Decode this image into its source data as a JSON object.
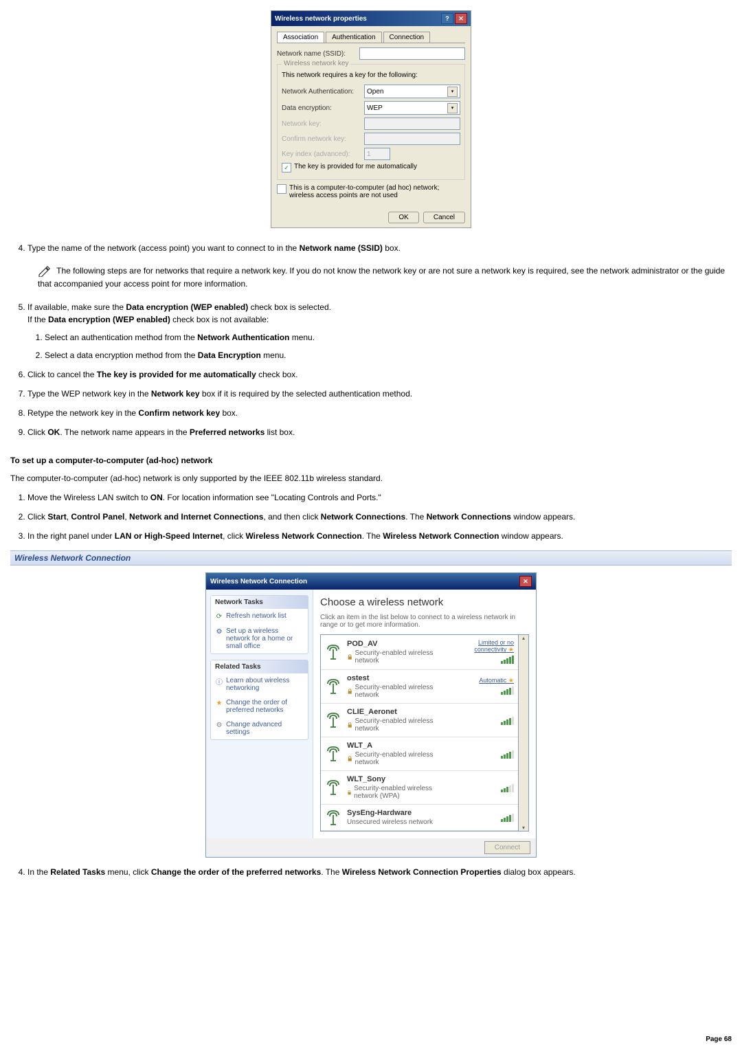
{
  "properties_dialog": {
    "title": "Wireless network properties",
    "tabs": {
      "association": "Association",
      "authentication": "Authentication",
      "connection": "Connection"
    },
    "network_name_label": "Network name (SSID):",
    "wireless_key_group": "Wireless network key",
    "requires_text": "This network requires a key for the following:",
    "net_auth_label": "Network Authentication:",
    "net_auth_value": "Open",
    "data_enc_label": "Data encryption:",
    "data_enc_value": "WEP",
    "net_key_label": "Network key:",
    "confirm_key_label": "Confirm network key:",
    "key_index_label": "Key index (advanced):",
    "key_index_value": "1",
    "auto_key_label": "The key is provided for me automatically",
    "adhoc_label": "This is a computer-to-computer (ad hoc) network; wireless access points are not used",
    "ok": "OK",
    "cancel": "Cancel"
  },
  "step4": "Type the name of the network (access point) you want to connect to in the ",
  "step4_bold": "Network name (SSID)",
  "step4_end": " box.",
  "note": "The following steps are for networks that require a network key. If you do not know the network key or are not sure a network key is required, see the network administrator or the guide that accompanied your access point for more information.",
  "step5a": "If available, make sure the ",
  "step5a_bold": "Data encryption (WEP enabled)",
  "step5a_end": " check box is selected.",
  "step5b": "If the ",
  "step5b_bold": "Data encryption (WEP enabled)",
  "step5b_end": " check box is not available:",
  "step5_1a": "Select an authentication method from the ",
  "step5_1b": "Network Authentication",
  "step5_1c": " menu.",
  "step5_2a": "Select a data encryption method from the ",
  "step5_2b": "Data Encryption",
  "step5_2c": " menu.",
  "step6a": "Click to cancel the ",
  "step6b": "The key is provided for me automatically",
  "step6c": " check box.",
  "step7a": "Type the WEP network key in the ",
  "step7b": "Network key",
  "step7c": " box if it is required by the selected authentication method.",
  "step8a": "Retype the network key in the ",
  "step8b": "Confirm network key",
  "step8c": " box.",
  "step9a": "Click ",
  "step9b": "OK",
  "step9c": ". The network name appears in the ",
  "step9d": "Preferred networks",
  "step9e": " list box.",
  "adhoc_heading": "To set up a computer-to-computer (ad-hoc) network",
  "adhoc_intro": "The computer-to-computer (ad-hoc) network is only supported by the IEEE 802.11b wireless standard.",
  "adhoc1a": "Move the Wireless LAN switch to ",
  "adhoc1b": "ON",
  "adhoc1c": ". For location information see \"Locating Controls and Ports.\"",
  "adhoc2a": "Click ",
  "adhoc2b": "Start",
  "adhoc2c": ", ",
  "adhoc2d": "Control Panel",
  "adhoc2e": ", ",
  "adhoc2f": "Network and Internet Connections",
  "adhoc2g": ", and then click ",
  "adhoc2h": "Network Connections",
  "adhoc2i": ". The ",
  "adhoc2j": "Network Connections",
  "adhoc2k": " window appears.",
  "adhoc3a": "In the right panel under ",
  "adhoc3b": "LAN or High-Speed Internet",
  "adhoc3c": ", click ",
  "adhoc3d": "Wireless Network Connection",
  "adhoc3e": ". The ",
  "adhoc3f": "Wireless Network Connection",
  "adhoc3g": " window appears.",
  "caption": "Wireless Network Connection",
  "wnc": {
    "title": "Wireless Network Connection",
    "net_tasks": "Network Tasks",
    "refresh": "Refresh network list",
    "setup": "Set up a wireless network for a home or small office",
    "related": "Related Tasks",
    "learn": "Learn about wireless networking",
    "change_order": "Change the order of preferred networks",
    "change_adv": "Change advanced settings",
    "choose": "Choose a wireless network",
    "desc": "Click an item in the list below to connect to a wireless network in range or to get more information.",
    "nets": [
      {
        "name": "POD_AV",
        "sec": "Security-enabled wireless network",
        "status": "Limited or no connectivity",
        "bars": 5
      },
      {
        "name": "ostest",
        "sec": "Security-enabled wireless network",
        "status": "Automatic",
        "bars": 4
      },
      {
        "name": "CLIE_Aeronet",
        "sec": "Security-enabled wireless network",
        "status": "",
        "bars": 4
      },
      {
        "name": "WLT_A",
        "sec": "Security-enabled wireless network",
        "status": "",
        "bars": 4
      },
      {
        "name": "WLT_Sony",
        "sec": "Security-enabled wireless network (WPA)",
        "status": "",
        "bars": 3
      },
      {
        "name": "SysEng-Hardware",
        "sec": "Unsecured wireless network",
        "status": "",
        "bars": 4
      }
    ],
    "connect": "Connect"
  },
  "step4b_a": "In the ",
  "step4b_b": "Related Tasks",
  "step4b_c": " menu, click ",
  "step4b_d": "Change the order of the preferred networks",
  "step4b_e": ". The ",
  "step4b_f": "Wireless Network Connection Properties",
  "step4b_g": " dialog box appears.",
  "page": "Page 68"
}
